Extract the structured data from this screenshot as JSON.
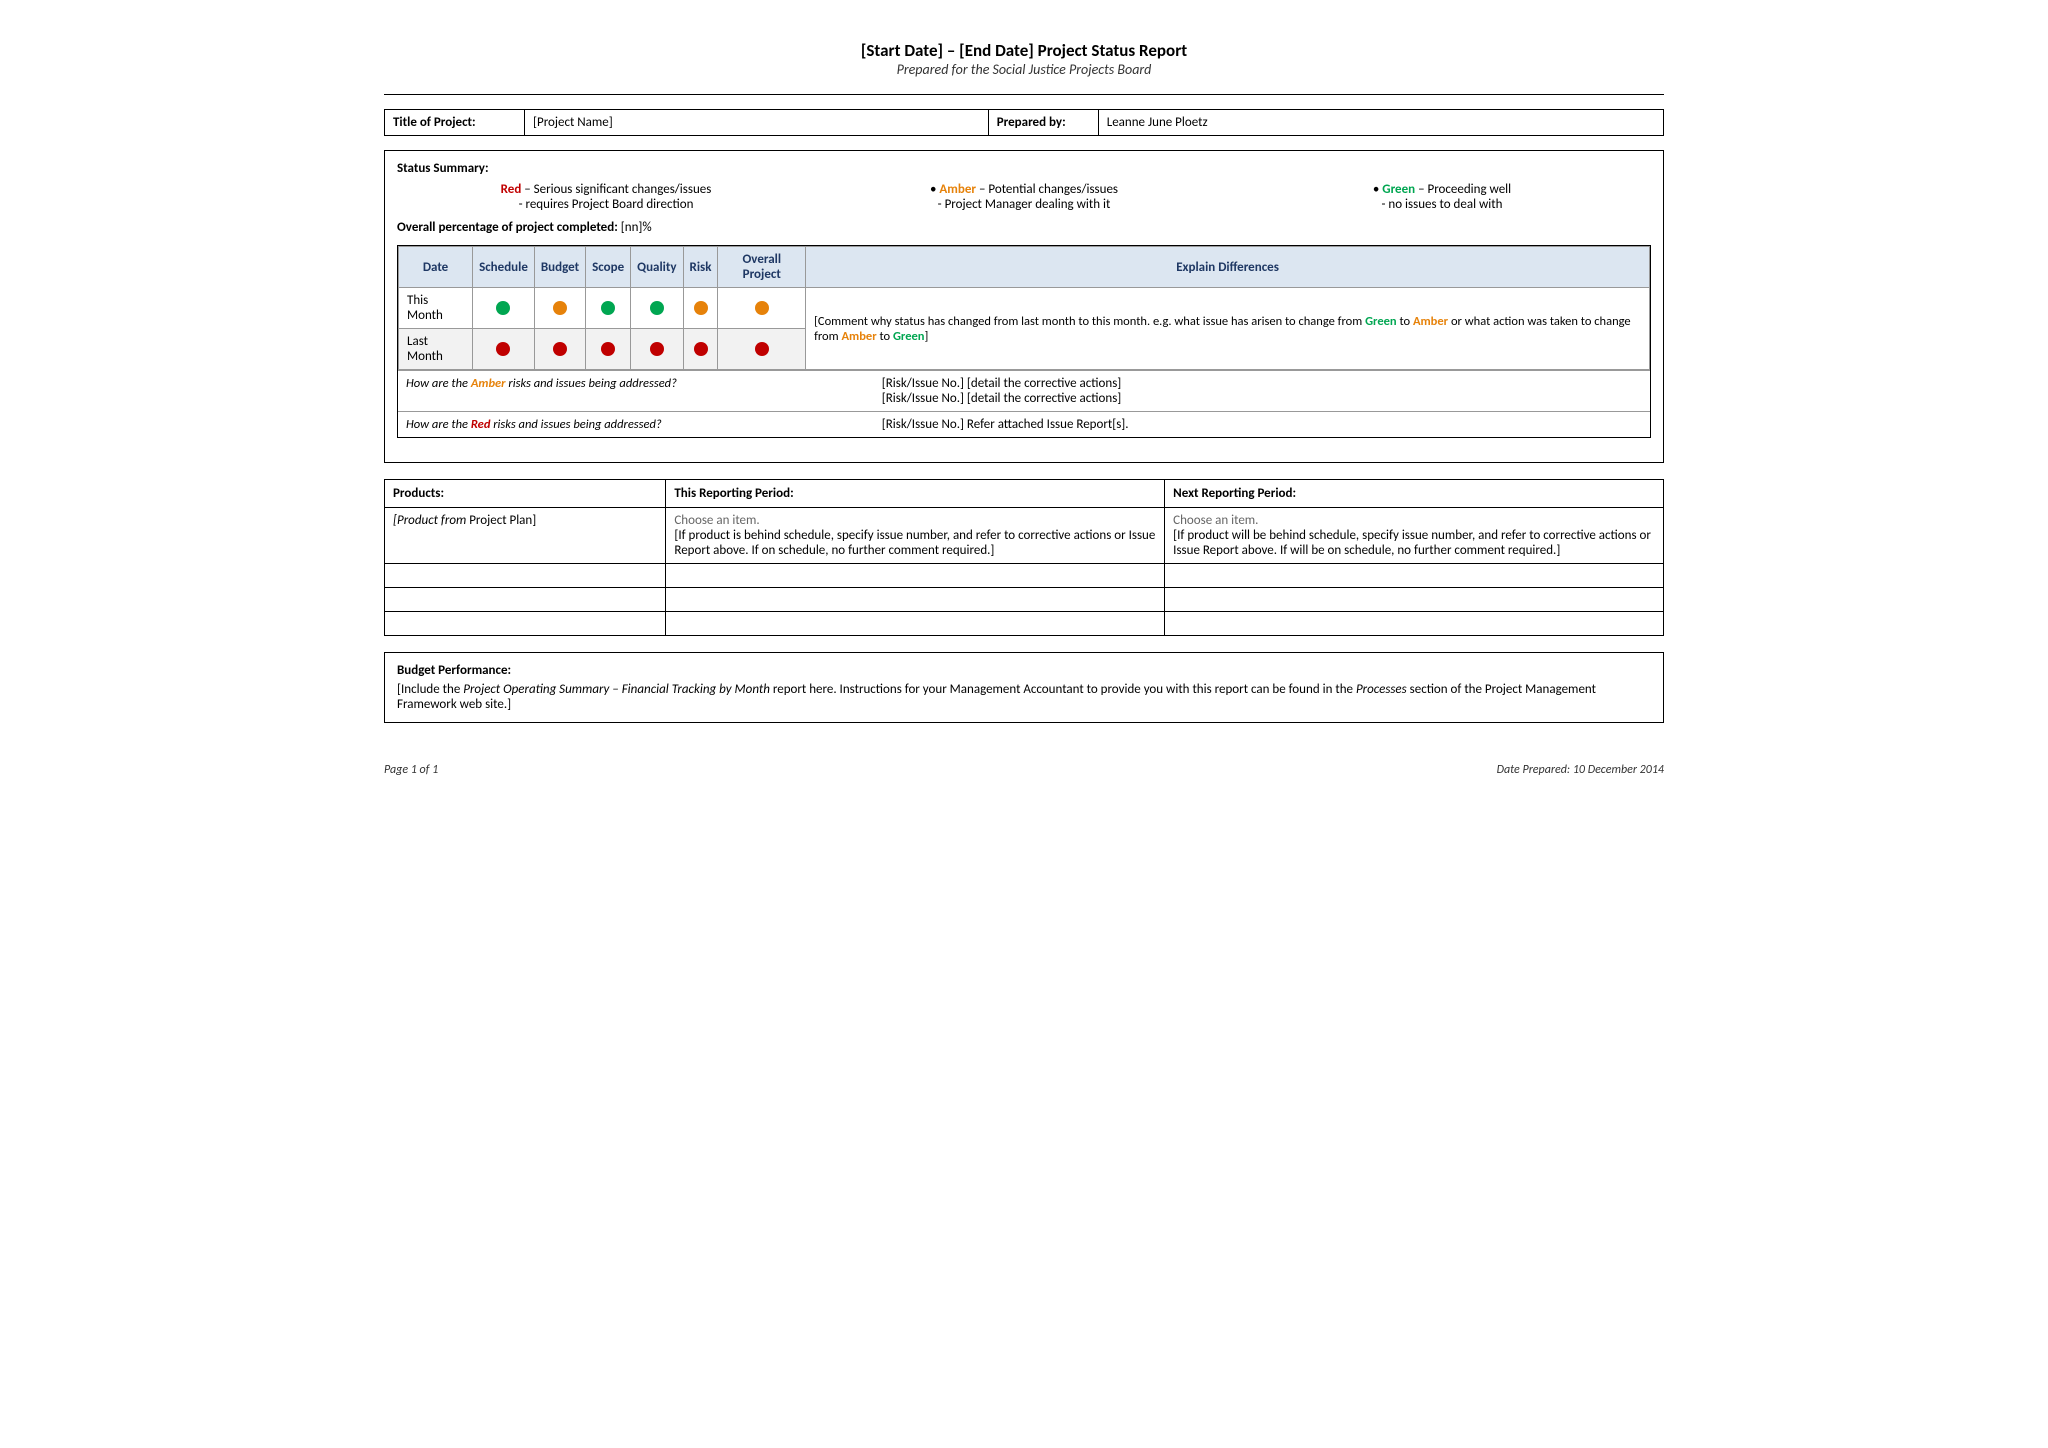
{
  "header": {
    "title": "[Start Date] – [End Date] Project Status Report",
    "subtitle": "Prepared for the Social Justice Projects Board"
  },
  "project_info": {
    "title_label": "Title of Project:",
    "project_name": "[Project Name]",
    "prepared_by_label": "Prepared by:",
    "prepared_by_value": "Leanne June Ploetz"
  },
  "status_summary": {
    "title": "Status Summary:",
    "red_label": "Red",
    "red_desc1": "– Serious significant changes/issues",
    "red_desc2": "- requires Project Board direction",
    "amber_bullet": "•",
    "amber_label": "Amber",
    "amber_desc1": "– Potential changes/issues",
    "amber_desc2": "- Project Manager dealing with it",
    "green_bullet": "•",
    "green_label": "Green",
    "green_desc1": "– Proceeding well",
    "green_desc2": "- no issues to deal with",
    "completion_prefix": "Overall percentage of project completed:",
    "completion_value": "[nn]%"
  },
  "status_table": {
    "headers": [
      "Date",
      "Schedule",
      "Budget",
      "Scope",
      "Quality",
      "Risk",
      "Overall Project",
      "Explain Differences"
    ],
    "this_month_label": "This Month",
    "last_month_label": "Last Month",
    "this_month_dots": [
      "green",
      "amber",
      "green",
      "green",
      "amber",
      "amber"
    ],
    "last_month_dots": [
      "red",
      "red",
      "red",
      "red",
      "red",
      "red"
    ],
    "explain_text": "[Comment why status has changed from last month to this month.  e.g. what issue has arisen to change from ",
    "explain_green": "Green",
    "explain_mid": " to ",
    "explain_amber": "Amber",
    "explain_mid2": " or what action was taken to change from ",
    "explain_amber2": "Amber",
    "explain_mid3": " to ",
    "explain_green2": "Green",
    "explain_end": "]"
  },
  "risk_rows": [
    {
      "question_prefix": "How are the ",
      "question_color_label": "Amber",
      "question_color": "amber",
      "question_suffix": " risks and issues being addressed?",
      "answer_line1": "[Risk/Issue No.]  [detail the corrective actions]",
      "answer_line2": "[Risk/Issue No.]  [detail the corrective actions]"
    },
    {
      "question_prefix": "How are the ",
      "question_color_label": "Red",
      "question_color": "red",
      "question_suffix": " risks and issues being addressed?",
      "answer_line1": "[Risk/Issue No.]  Refer attached Issue Report[s].",
      "answer_line2": ""
    }
  ],
  "products": {
    "col_products": "Products:",
    "col_this": "This Reporting Period:",
    "col_next": "Next Reporting Period:",
    "rows": [
      {
        "product": "[Product from Project Plan]",
        "this_dropdown": "Choose an item.",
        "this_desc": "[If product is behind schedule, specify issue number, and refer to corrective actions or Issue Report above.  If on schedule, no further comment required.]",
        "next_dropdown": "Choose an item.",
        "next_desc": "[If product will be behind schedule, specify issue number, and refer to corrective actions or Issue Report above.  If will be on schedule, no further comment required.]"
      },
      {
        "product": "",
        "this_dropdown": "",
        "this_desc": "",
        "next_dropdown": "",
        "next_desc": ""
      },
      {
        "product": "",
        "this_dropdown": "",
        "this_desc": "",
        "next_dropdown": "",
        "next_desc": ""
      },
      {
        "product": "",
        "this_dropdown": "",
        "this_desc": "",
        "next_dropdown": "",
        "next_desc": ""
      }
    ]
  },
  "budget": {
    "title": "Budget Performance:",
    "text_prefix": "[Include the ",
    "text_italic1": "Project Operating Summary – Financial Tracking by Month",
    "text_mid": " report here.  Instructions for your Management Accountant to provide you with this report can be found in the ",
    "text_italic2": "Processes",
    "text_suffix": " section of the Project Management Framework web site.]"
  },
  "footer": {
    "page_info": "Page 1 of 1",
    "date_prepared": "Date Prepared:  10 December 2014"
  }
}
